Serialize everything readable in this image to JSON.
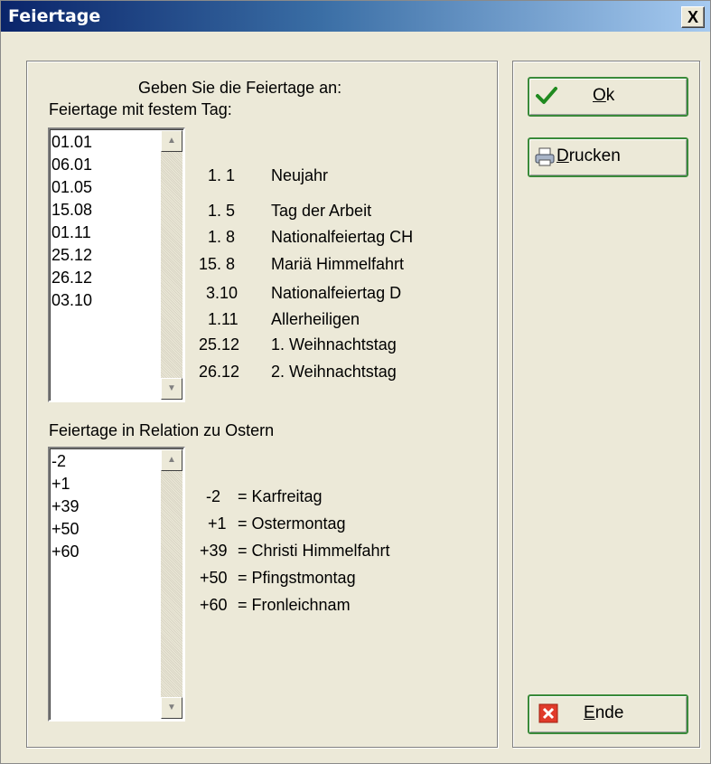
{
  "window": {
    "title": "Feiertage",
    "close_label": "X"
  },
  "instructions": "Geben Sie die Feiertage an:",
  "fixed_section": {
    "label": "Feiertage mit festem Tag:",
    "list": [
      "01.01",
      "06.01",
      "01.05",
      "15.08",
      "01.11",
      "25.12",
      "26.12",
      "03.10"
    ],
    "legend": [
      {
        "date": "1. 1",
        "name": "Neujahr"
      },
      {
        "date": "1. 5",
        "name": "Tag der Arbeit"
      },
      {
        "date": "1. 8",
        "name": "Nationalfeiertag CH"
      },
      {
        "date": "15. 8",
        "name": "Mariä Himmelfahrt"
      },
      {
        "date": "3.10",
        "name": "Nationalfeiertag D"
      },
      {
        "date": "1.11",
        "name": "Allerheiligen"
      },
      {
        "date": "25.12",
        "name": "1. Weihnachtstag"
      },
      {
        "date": "26.12",
        "name": "2. Weihnachtstag"
      }
    ]
  },
  "easter_section": {
    "label": "Feiertage in Relation zu Ostern",
    "list": [
      "-2",
      "+1",
      "+39",
      "+50",
      "+60"
    ],
    "legend": [
      {
        "offset": "-2",
        "name": "= Karfreitag"
      },
      {
        "offset": "+1",
        "name": "= Ostermontag"
      },
      {
        "offset": "+39",
        "name": "= Christi Himmelfahrt"
      },
      {
        "offset": "+50",
        "name": "= Pfingstmontag"
      },
      {
        "offset": "+60",
        "name": "= Fronleichnam"
      }
    ]
  },
  "buttons": {
    "ok": {
      "accel": "O",
      "rest": "k",
      "icon": "checkmark-icon"
    },
    "print": {
      "accel": "D",
      "rest": "rucken",
      "icon": "printer-icon"
    },
    "end": {
      "accel": "E",
      "rest": "nde",
      "icon": "close-x-icon"
    }
  },
  "colors": {
    "title_start": "#0a246a",
    "title_end": "#a6caf0",
    "button_border": "#3a8a3a",
    "dialog_bg": "#ece9d8"
  }
}
